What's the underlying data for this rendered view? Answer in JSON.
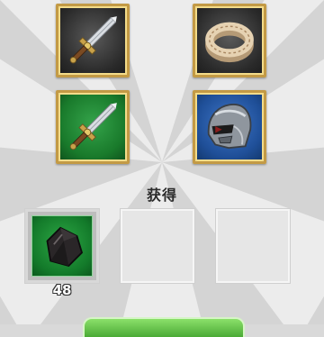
{
  "equipment_slots": [
    {
      "item": "sword-icon",
      "background": "dark"
    },
    {
      "item": "ring-icon",
      "background": "dark"
    },
    {
      "item": "sword-icon",
      "background": "green"
    },
    {
      "item": "helmet-icon",
      "background": "blue"
    }
  ],
  "rewards": {
    "title": "获得",
    "slots": [
      {
        "item": "ore-stone-icon",
        "quantity": "48"
      },
      {
        "item": null,
        "quantity": ""
      },
      {
        "item": null,
        "quantity": ""
      }
    ]
  },
  "colors": {
    "frame_gold": "#c39a45",
    "dark_bg": "#2a2a2a",
    "green_bg": "#197a2b",
    "blue_bg": "#1f4f98",
    "button_green": "#5ec043"
  }
}
